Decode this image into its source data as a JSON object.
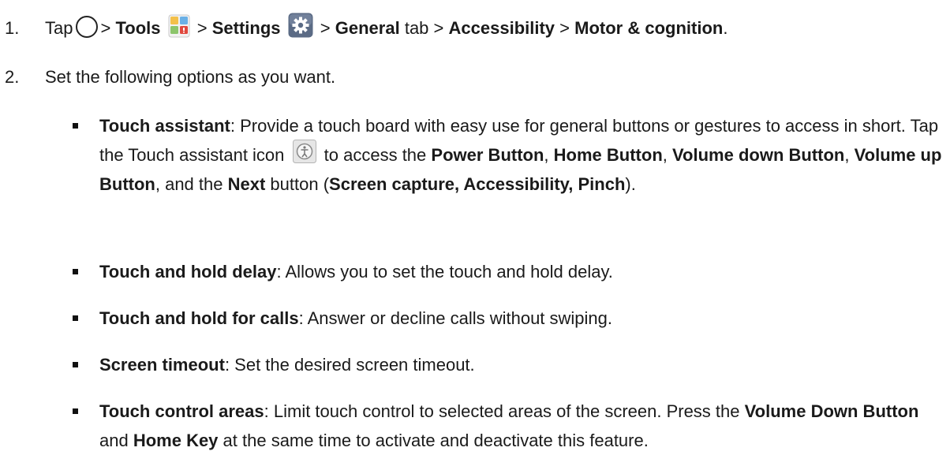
{
  "step1": {
    "number": "1.",
    "tap": "Tap",
    "sep": ">",
    "tools": "Tools",
    "settings": "Settings",
    "general": "General",
    "tab": "tab",
    "accessibility": "Accessibility",
    "motor": "Motor & cognition",
    "period": "."
  },
  "step2": {
    "number": "2.",
    "text": "Set the following options as you want."
  },
  "bullets": {
    "touch_assistant": {
      "title": "Touch assistant",
      "colon": ":",
      "text1": " Provide a touch board with easy use for general buttons or gestures to access in short. Tap the Touch assistant icon",
      "text2": "to access the",
      "power": "Power Button",
      "comma": ",",
      "home": "Home Button",
      "voldown": "Volume down Button",
      "volup": "Volume up Button",
      "and_the": ", and the",
      "next": "Next",
      "button_paren": " button (",
      "extras": "Screen capture, Accessibility, Pinch",
      "close": ")."
    },
    "touch_hold_delay": {
      "title": "Touch and hold delay",
      "text": ": Allows you to set the touch and hold delay."
    },
    "touch_hold_calls": {
      "title": "Touch and hold for calls",
      "text": ": Answer or decline calls without swiping."
    },
    "screen_timeout": {
      "title": "Screen timeout",
      "text": ": Set the desired screen timeout."
    },
    "touch_control": {
      "title": "Touch control areas",
      "text1": ": Limit touch control to selected areas of the screen. Press the ",
      "voldown": "Volume Down Button",
      "and": " and ",
      "homekey": "Home Key",
      "text2": " at the same time to activate and deactivate this feature."
    }
  },
  "icons": {
    "home": "home-circle-icon",
    "tools": "tools-folder-icon",
    "settings": "settings-gear-icon",
    "touch_assistant": "touch-assistant-icon"
  },
  "colors": {
    "text": "#1a1a1a",
    "settings_icon_bg": "#5b6b85",
    "tools_icon_blue": "#6ab0e6",
    "tools_icon_red": "#e0483e"
  }
}
